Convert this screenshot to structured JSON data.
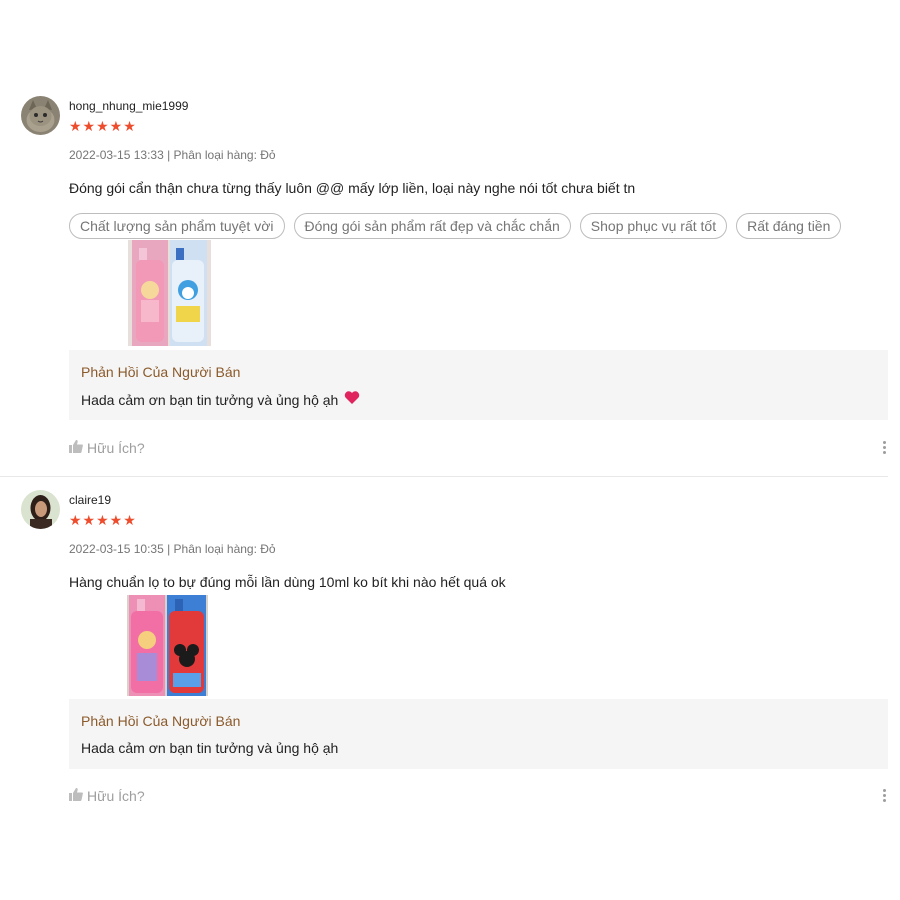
{
  "reviews": [
    {
      "username": "hong_nhung_mie1999",
      "stars": "★★★★★",
      "date_variant": "2022-03-15 13:33 | Phân loại hàng: Đỏ",
      "content": "Đóng gói cẩn thận chưa từng thấy luôn @@ mấy lớp liền, loại này nghe nói tốt chưa biết tn",
      "tags": [
        "Chất lượng sản phẩm tuyệt vời",
        "Đóng gói sản phẩm rất đẹp và chắc chắn",
        "Shop phục vụ rất tốt",
        "Rất đáng tiền"
      ],
      "seller_reply_title": "Phản Hồi Của Người Bán",
      "seller_reply_text": "Hada cảm ơn bạn tin tưởng và ủng hộ ạh",
      "helpful_label": "Hữu Ích?",
      "avatar_icon": "cat-avatar-icon",
      "reply_icon": "heart-icon"
    },
    {
      "username": "claire19",
      "stars": "★★★★★",
      "date_variant": "2022-03-15 10:35 | Phân loại hàng: Đỏ",
      "content": "Hàng chuẩn lọ to bự đúng mỗi lần dùng 10ml ko bít khi nào hết quá ok",
      "seller_reply_title": "Phản Hồi Của Người Bán",
      "seller_reply_text": "Hada cảm ơn bạn tin tưởng và ủng hộ ạh",
      "helpful_label": "Hữu Ích?",
      "avatar_icon": "portrait-avatar-icon"
    }
  ],
  "colors": {
    "star": "#ee4d2d",
    "reply_bg": "#f5f5f5",
    "reply_title": "#8b5a2b",
    "muted": "#757575"
  }
}
